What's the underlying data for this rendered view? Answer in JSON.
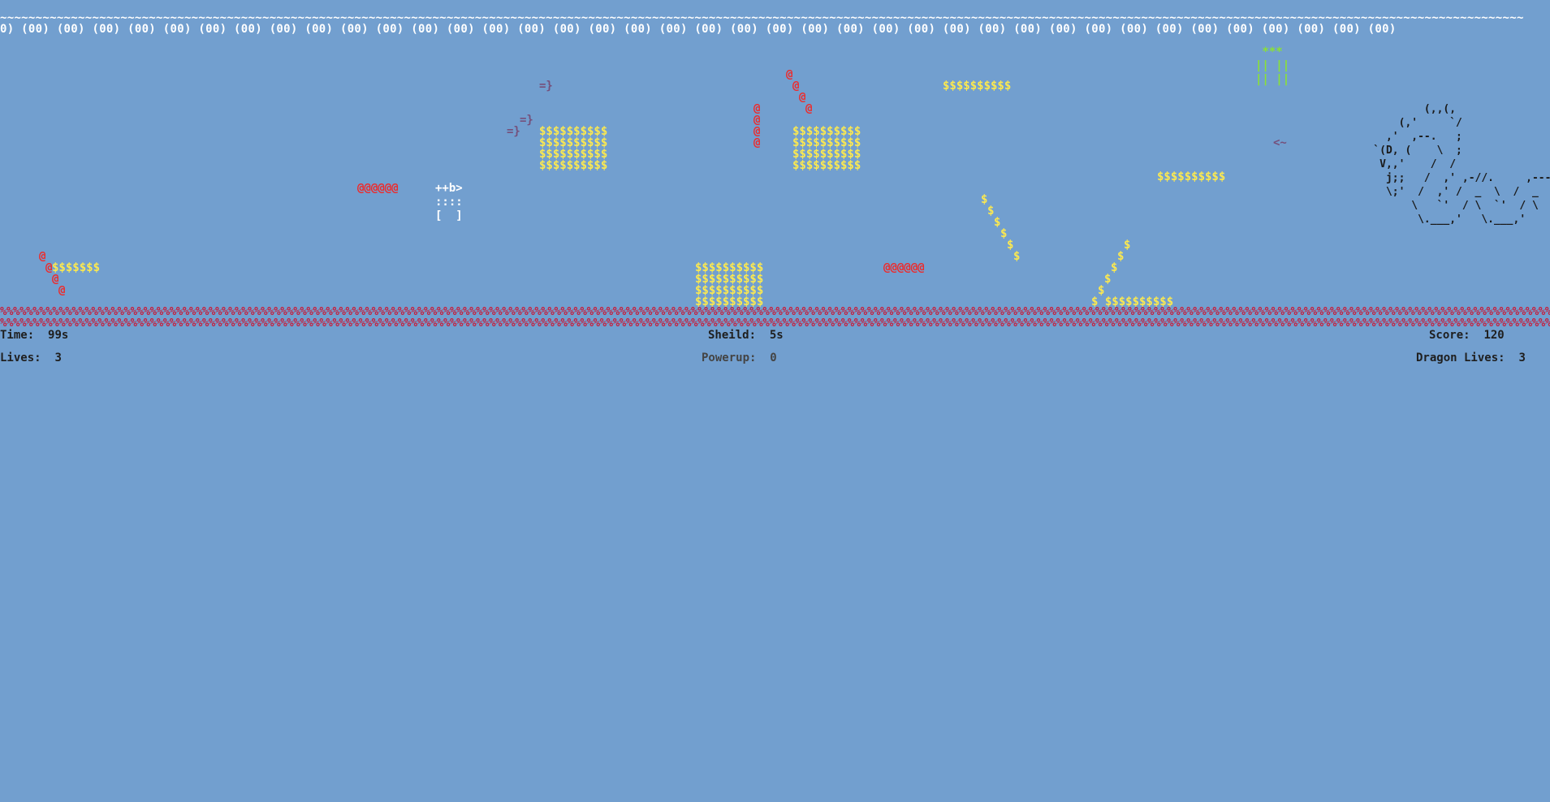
{
  "sky": {
    "border": "~~~~~~~~~~~~~~~~~~~~~~~~~~~~~~~~~~~~~~~~~~~~~~~~~~~~~~~~~~~~~~~~~~~~~~~~~~~~~~~~~~~~~~~~~~~~~~~~~~~~~~~~~~~~~~~~~~~~~~~~~~~~~~~~~~~~~~~~~~~~~~~~~~~~~~~~~~~~~~~~~~~~~~~~~~~~~~~~~~~~~~~~~~~~~~~~~~~~~~~~~~~~~~~~~~~~~~~",
    "clouds": "0) (00) (00) (00) (00) (00) (00) (00) (00) (00) (00) (00) (00) (00) (00) (00) (00) (00) (00) (00) (00) (00) (00) (00) (00) (00) (00) (00) (00) (00) (00) (00) (00) (00) (00) (00) (00) (00) (00) (00)"
  },
  "ground": {
    "row": "%%%%%%%%%%%%%%%%%%%%%%%%%%%%%%%%%%%%%%%%%%%%%%%%%%%%%%%%%%%%%%%%%%%%%%%%%%%%%%%%%%%%%%%%%%%%%%%%%%%%%%%%%%%%%%%%%%%%%%%%%%%%%%%%%%%%%%%%%%%%%%%%%%%%%%%%%%%%%%%%%%%%%%%%%%%%%%%%%%%%%%%%%%%%%%%%%%%%%%%%%%%%%%%%%%%%%%%%%%%%%%%%%%%%%%%%%%%%%%%%%%%%%"
  },
  "sprites": {
    "coin_block_row": "$$$$$$$$$$",
    "coin_small_row": "$$$$$$$",
    "coin_single": "$",
    "coin_tail": "$ $$$$$$$$$$",
    "obstacle_char": "@",
    "obstacle_row": "@@@@@@",
    "enemy": "=}",
    "bullet": "<~",
    "player": "++b>\n::::\n[  ]",
    "magnet": " ***\n|| ||\n|| ||",
    "dragon": "            (,,(,\n        (,'     `/\n      ,'  ,--.   ;\n    `(D, (    \\  ;\n     V,,'    /  /\n      j;;   /  ,' ,-//.     ,---.\n      \\;'  /  ,' /  _  \\  /  _  \\\n          \\   `'  / \\  `'  / \\  `\n           \\.___,'   \\.___,'   "
  },
  "hud": {
    "time_label": "Time:",
    "time_value": "99s",
    "shield_label": "Sheild:",
    "shield_value": "5s",
    "score_label": "Score:",
    "score_value": "120",
    "lives_label": "Lives:",
    "lives_value": "3",
    "powerup_label": "Powerup:",
    "powerup_value": "0",
    "dragon_lives_label": "Dragon Lives:",
    "dragon_lives_value": "3"
  },
  "colors": {
    "background": "#729fcf",
    "coin": "#fce94f",
    "obstacle": "#ef2929",
    "enemy": "#75507b",
    "magnet": "#8ae234",
    "ground": "#c4213f"
  }
}
